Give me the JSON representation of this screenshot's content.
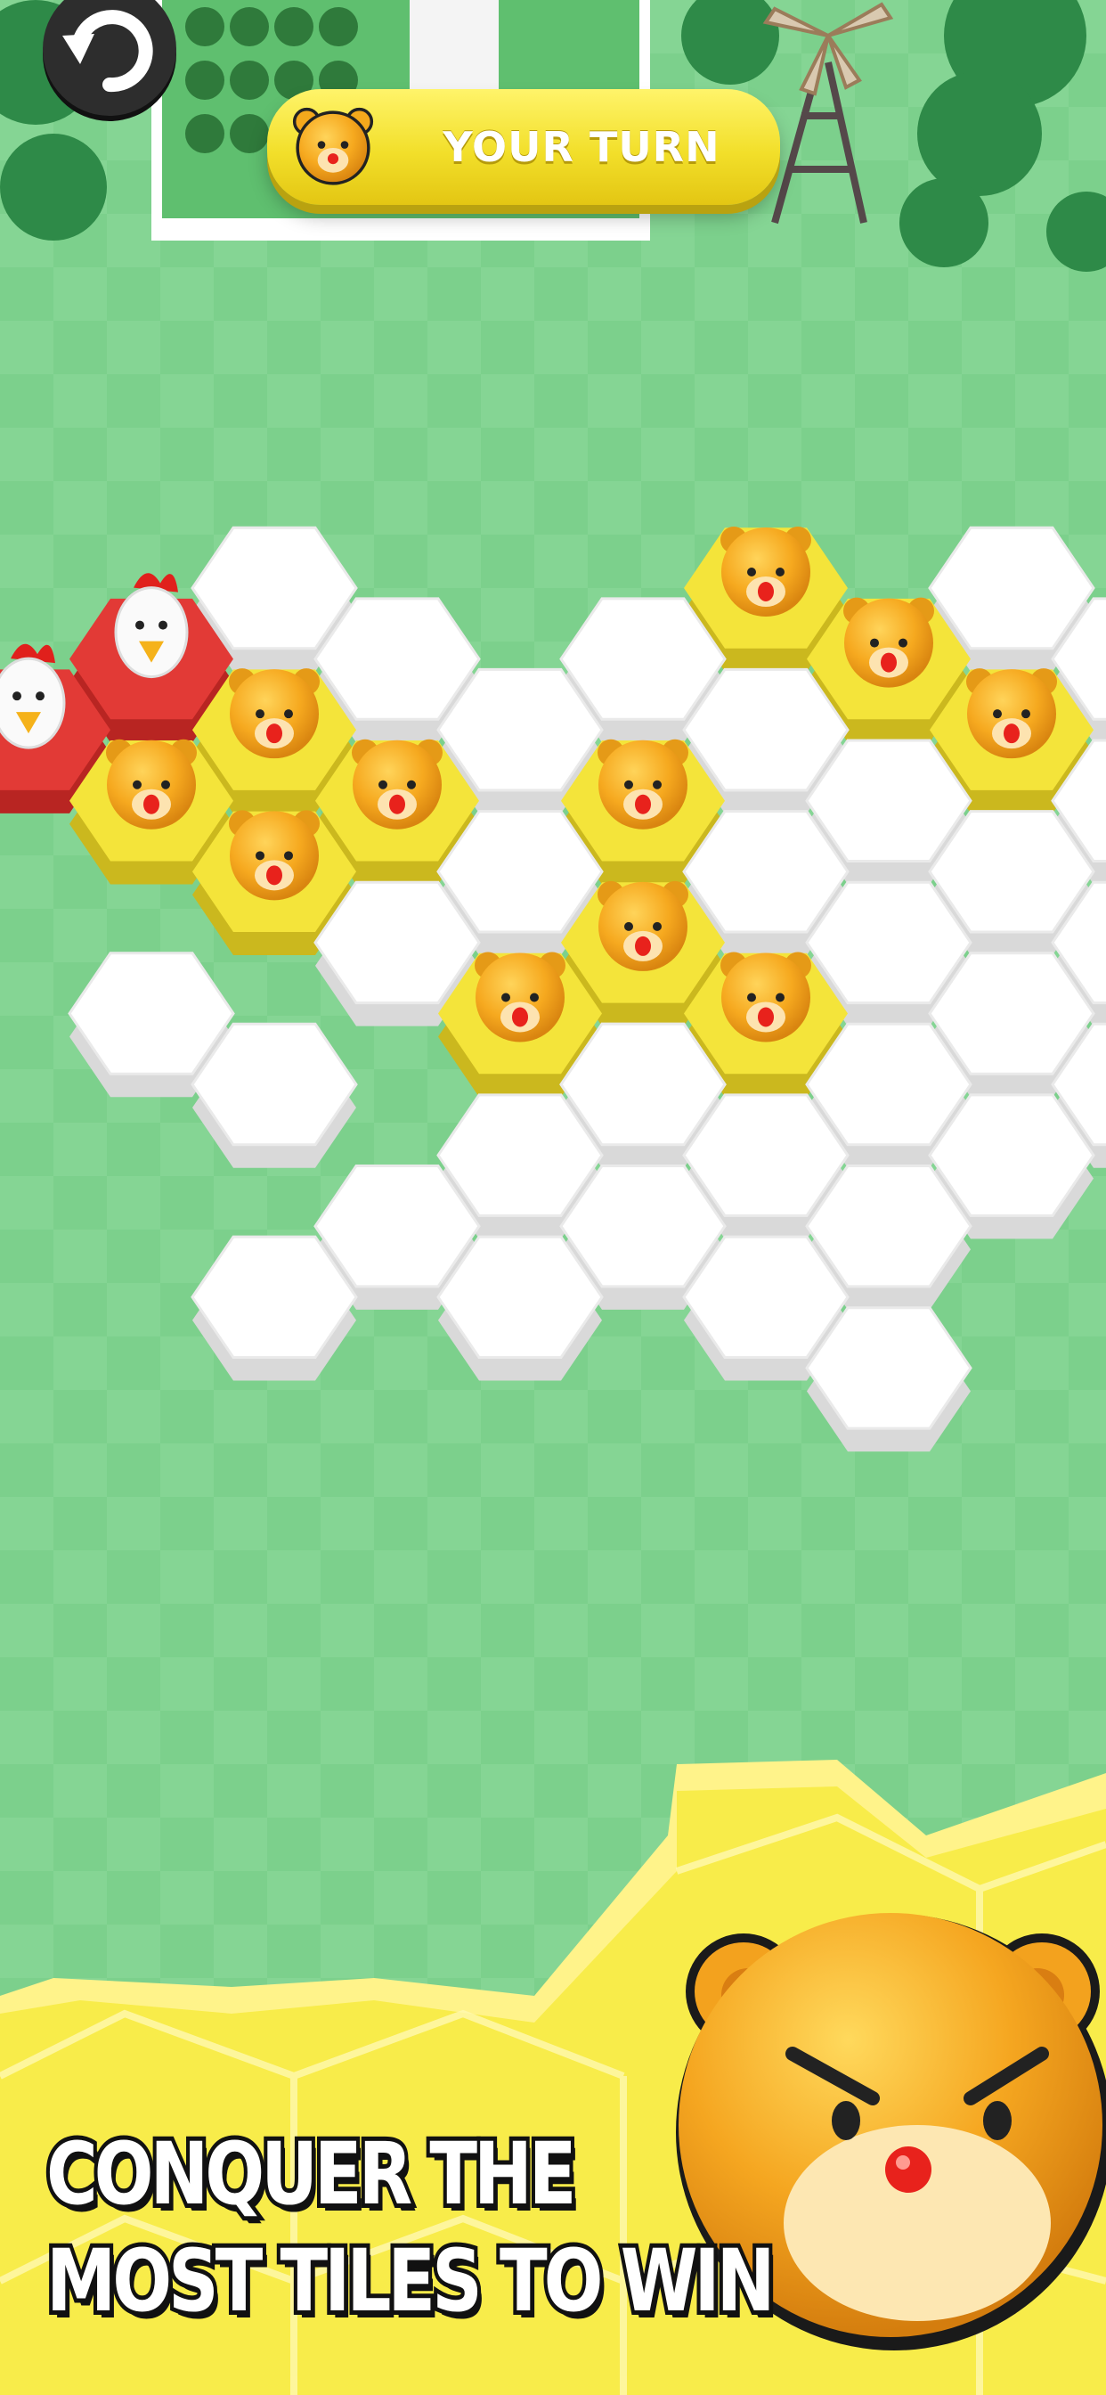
{
  "hud": {
    "turn_label": "YOUR TURN"
  },
  "controls": {
    "undo_icon": "undo-arrow-icon"
  },
  "board": {
    "tile_colors": {
      "empty": "#ffffff",
      "player": "#f4e43a",
      "opponent": "#e23a36"
    }
  },
  "promo": {
    "line1": "CONQUER THE",
    "line2": "MOST TILES TO WIN"
  },
  "colors": {
    "grass": "#7cd08c",
    "banner_yellow": "#f2df2a",
    "bear": "#f4a81c"
  }
}
